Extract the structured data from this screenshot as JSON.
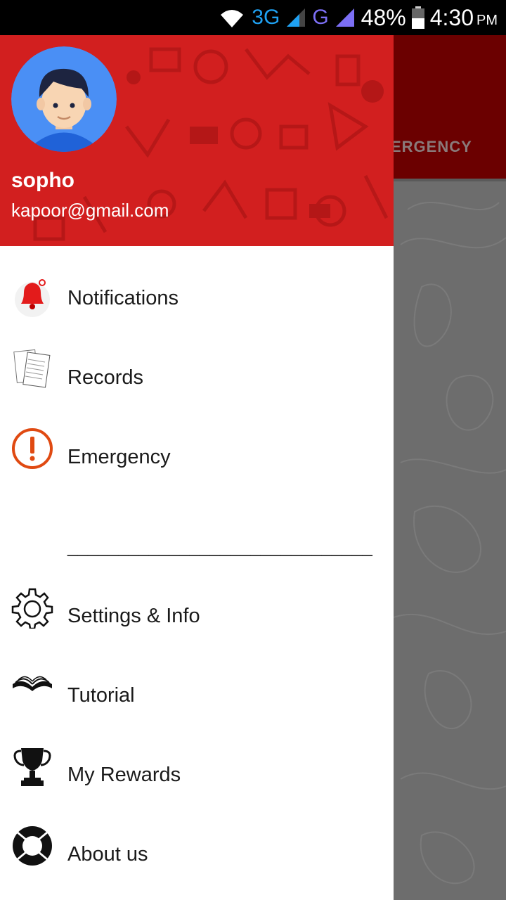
{
  "status_bar": {
    "network_3g": "3G",
    "network_g": "G",
    "battery": "48%",
    "time": "4:30",
    "ampm": "PM"
  },
  "background_app": {
    "tab_label": "ERGENCY"
  },
  "drawer": {
    "user": {
      "name": "sopho",
      "email": "kapoor@gmail.com"
    },
    "items": [
      {
        "label": "Notifications",
        "icon": "bell-icon"
      },
      {
        "label": "Records",
        "icon": "records-icon"
      },
      {
        "label": "Emergency",
        "icon": "alert-icon"
      }
    ],
    "separator": "______________________________",
    "items2": [
      {
        "label": "Settings & Info",
        "icon": "gear-icon"
      },
      {
        "label": "Tutorial",
        "icon": "book-icon"
      },
      {
        "label": "My Rewards",
        "icon": "trophy-icon"
      },
      {
        "label": "About us",
        "icon": "lifebuoy-icon"
      }
    ]
  },
  "colors": {
    "header_red": "#d21f1f",
    "toolbar_dark_red": "#6b0000",
    "emergency_orange": "#e04a12"
  }
}
